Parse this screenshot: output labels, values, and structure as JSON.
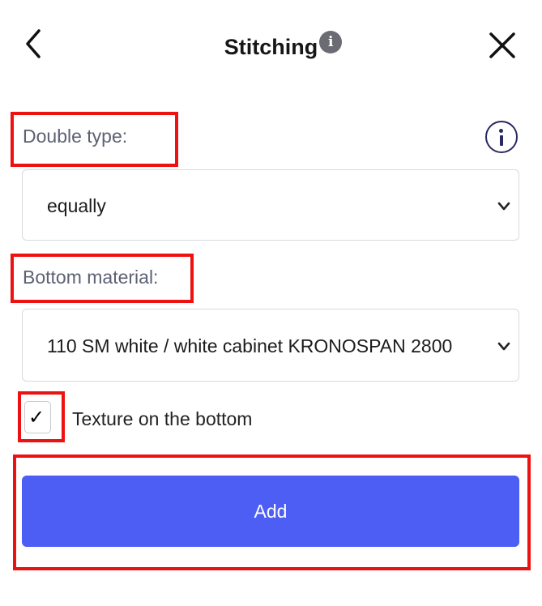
{
  "header": {
    "title": "Stitching",
    "title_info_glyph": "i",
    "back_icon": "chevron-left-icon",
    "close_icon": "close-icon"
  },
  "form": {
    "double_type": {
      "label": "Double type:",
      "value": "equally",
      "info_icon": "info-icon"
    },
    "bottom_material": {
      "label": "Bottom material:",
      "value": "110 SM white / white cabinet KRONOSPAN 2800"
    },
    "texture": {
      "label": "Texture on the bottom",
      "checked": true,
      "check_glyph": "✓"
    },
    "add_button": {
      "label": "Add"
    }
  },
  "colors": {
    "accent": "#4d5ef5",
    "highlight": "#ee1111",
    "label_text": "#5d6174"
  }
}
